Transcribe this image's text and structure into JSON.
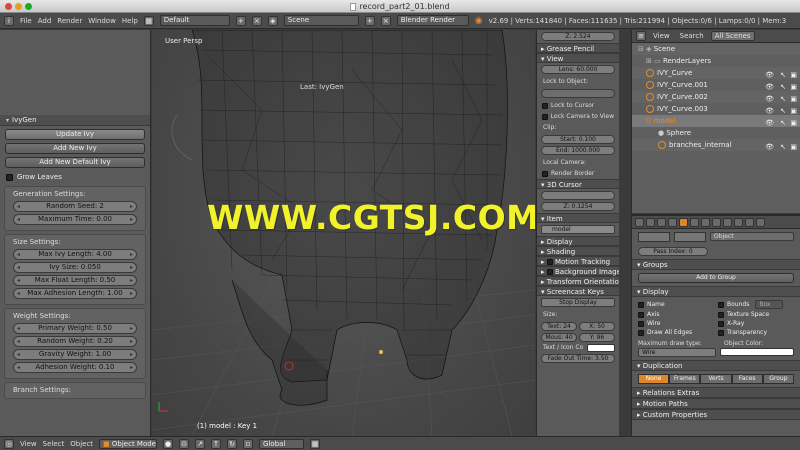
{
  "window": {
    "title": "record_part2_01.blend"
  },
  "infobar": {
    "menus": [
      "File",
      "Add",
      "Render",
      "Window",
      "Help"
    ],
    "layout": "Default",
    "scene": "Scene",
    "engine": "Blender Render",
    "stats": "v2.69 | Verts:141840 | Faces:111635 | Tris:211994 | Objects:0/6 | Lamps:0/0 | Mem:3"
  },
  "toolshelf": {
    "panel_title": "IvyGen",
    "buttons": [
      "Update Ivy",
      "Add New Ivy",
      "Add New Default Ivy"
    ],
    "grow_leaves": "Grow Leaves",
    "generation": {
      "title": "Generation Settings:",
      "fields": [
        "Random Seed: 2",
        "Maximum Time: 0.00"
      ]
    },
    "size": {
      "title": "Size Settings:",
      "fields": [
        "Max Ivy Length: 4.00",
        "Ivy Size: 0.050",
        "Max Float Length: 0.50",
        "Max Adhesion Length: 1.00"
      ]
    },
    "weight": {
      "title": "Weight Settings:",
      "fields": [
        "Primary Weight: 0.50",
        "Random Weight: 0.20",
        "Gravity Weight: 1.00",
        "Adhesion Weight: 0.10"
      ]
    },
    "branch": {
      "title": "Branch Settings:"
    }
  },
  "viewport": {
    "view_label": "User Persp",
    "last_label": "Last: IvyGen",
    "object_label": "(1) model : Key 1",
    "watermark": "WWW.CGTSJ.COM",
    "watermark_color": "#f2f22a"
  },
  "npanel": {
    "top_field": "Z: 2.524",
    "grease_pencil": "Grease Pencil",
    "view": "View",
    "lens": "Lens: 60.000",
    "lock_to_object": "Lock to Object:",
    "lock_to_cursor": "Lock to Cursor",
    "lock_camera": "Lock Camera to View",
    "clip": "Clip:",
    "clip_start": "Start: 0.100",
    "clip_end": "End: 1000.000",
    "local_camera": "Local Camera:",
    "render_border": "Render Border",
    "cursor": "3D Cursor",
    "cursor_z": "Z: 0.1254",
    "item": "Item",
    "item_name": "model",
    "display": "Display",
    "shading": "Shading",
    "motion_tracking": "Motion Tracking",
    "background_images": "Background Images",
    "transform_orientations": "Transform Orientations",
    "screencast": "Screencast Keys",
    "stop_display": "Stop Display",
    "size_label": "Size:",
    "text_size": "Text: 24",
    "mouse_size": "Mous: 40",
    "x": "X: 50",
    "y": "Y: 96",
    "text_icon": "Text / Icon Co",
    "fade_out": "Fade Out Time: 3.50"
  },
  "outliner": {
    "tabs": [
      "View",
      "Search",
      "All Scenes"
    ],
    "rows": [
      {
        "label": "Scene",
        "indent": 0
      },
      {
        "label": "RenderLayers",
        "indent": 1
      },
      {
        "label": "IVY_Curve",
        "indent": 1
      },
      {
        "label": "IVY_Curve.001",
        "indent": 1
      },
      {
        "label": "IVY_Curve.002",
        "indent": 1
      },
      {
        "label": "IVY_Curve.003",
        "indent": 1
      },
      {
        "label": "model",
        "indent": 1
      },
      {
        "label": "Sphere",
        "indent": 2
      },
      {
        "label": "branches_internal",
        "indent": 2
      }
    ]
  },
  "properties": {
    "object_dd": "Object",
    "pass_index": "Pass Index: 0",
    "groups": "Groups",
    "add_to_group": "Add to Group",
    "display": "Display",
    "checks": [
      "Name",
      "Bounds",
      "Axis",
      "Texture Space",
      "Wire",
      "X-Ray",
      "Draw All Edges",
      "Transparency"
    ],
    "bounds_dd": "Box",
    "max_draw_type": "Maximum draw type:",
    "object_color": "Object Color:",
    "draw_type": "Wire",
    "duplication": "Duplication",
    "dup_tabs": [
      "None",
      "Frames",
      "Verts",
      "Faces",
      "Group"
    ],
    "relations_extras": "Relations Extras",
    "motion_paths": "Motion Paths",
    "custom_properties": "Custom Properties"
  },
  "bottombar": {
    "menus": [
      "View",
      "Select",
      "Object"
    ],
    "mode": "Object Mode",
    "orientation": "Global"
  },
  "colors": {
    "accent": "#e0862a",
    "active_tab": "#e0862a"
  }
}
